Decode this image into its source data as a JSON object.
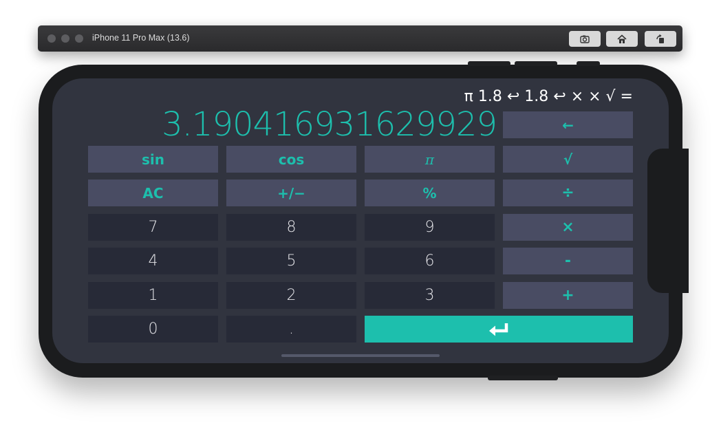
{
  "window": {
    "title": "iPhone 11 Pro Max (13.6)",
    "buttons": [
      "screenshot-icon",
      "home-icon",
      "rotate-icon"
    ]
  },
  "calculator": {
    "history": "π 1.8 ↩ 1.8 ↩ × × √ =",
    "display": "3.1904169316299 29",
    "keys": {
      "backspace": "←",
      "sin": "sin",
      "cos": "cos",
      "pi": "π",
      "sqrt": "√",
      "ac": "AC",
      "negate": "+/−",
      "percent": "%",
      "divide": "÷",
      "seven": "7",
      "eight": "8",
      "nine": "9",
      "multiply": "×",
      "four": "4",
      "five": "5",
      "six": "6",
      "subtract": "-",
      "one": "1",
      "two": "2",
      "three": "3",
      "add": "+",
      "zero": "0",
      "decimal": ".",
      "enter": "enter-icon"
    }
  },
  "colors": {
    "accent": "#1dbfad",
    "screen_bg": "#31343f",
    "fn_key": "#494c63",
    "num_key": "#272a37"
  }
}
